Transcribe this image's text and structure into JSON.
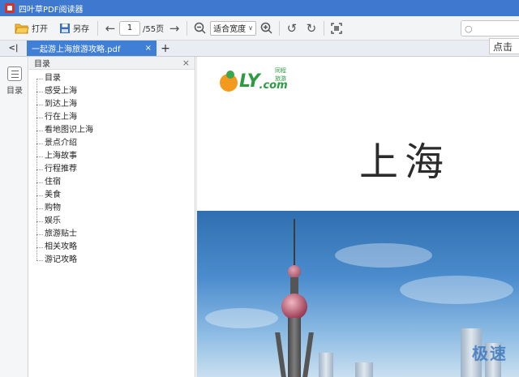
{
  "window": {
    "title": "四叶草PDF阅读器"
  },
  "toolbar": {
    "open_label": "打开",
    "save_as_label": "另存",
    "current_page": "1",
    "total_pages": "/55页",
    "zoom_mode": "适合宽度"
  },
  "tooltip": {
    "text": "点击"
  },
  "tabs": [
    {
      "label": "一起游上海旅游攻略.pdf",
      "active": true
    }
  ],
  "sidebar": {
    "rail_label": "目录"
  },
  "outline": {
    "header": "目录",
    "items": [
      "目录",
      "感受上海",
      "到达上海",
      "行在上海",
      "看地图识上海",
      "景点介绍",
      "上海故事",
      "行程推荐",
      "住宿",
      "美食",
      "购物",
      "娱乐",
      "旅游贴士",
      "相关攻略",
      "游记攻略"
    ]
  },
  "document": {
    "logo_text": "LY",
    "logo_suffix": ".com",
    "logo_tagline": "同程旅游",
    "heading": "上海"
  },
  "watermark": {
    "text": "极速"
  },
  "colors": {
    "titlebar": "#3e79cf",
    "active_tab": "#3f7fd6",
    "logo_green": "#2d9b42"
  }
}
